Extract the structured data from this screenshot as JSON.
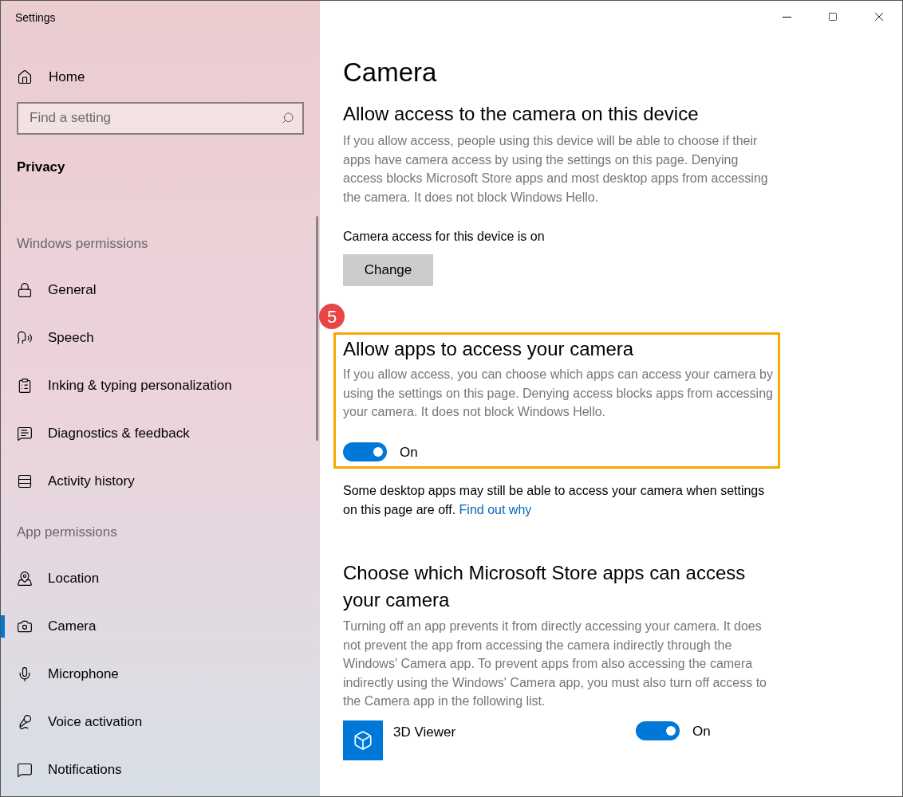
{
  "window": {
    "title": "Settings"
  },
  "sidebar": {
    "home": "Home",
    "search": {
      "placeholder": "Find a setting"
    },
    "section_title": "Privacy",
    "groups": [
      {
        "heading": "Windows permissions",
        "items": [
          {
            "label": "General",
            "selected": false
          },
          {
            "label": "Speech",
            "selected": false
          },
          {
            "label": "Inking & typing personalization",
            "selected": false
          },
          {
            "label": "Diagnostics & feedback",
            "selected": false
          },
          {
            "label": "Activity history",
            "selected": false
          }
        ]
      },
      {
        "heading": "App permissions",
        "items": [
          {
            "label": "Location",
            "selected": false
          },
          {
            "label": "Camera",
            "selected": true
          },
          {
            "label": "Microphone",
            "selected": false
          },
          {
            "label": "Voice activation",
            "selected": false
          },
          {
            "label": "Notifications",
            "selected": false
          }
        ]
      }
    ]
  },
  "page": {
    "title": "Camera",
    "sections": [
      {
        "kind": "device",
        "heading": "Allow access to the camera on this device",
        "description": "If you allow access, people using this device will be able to choose if their apps have camera access by using the settings on this page. Denying access blocks Microsoft Store apps and most desktop apps from accessing the camera. It does not block Windows Hello.",
        "status": "Camera access for this device is on",
        "button": "Change"
      },
      {
        "kind": "toggle",
        "badge": "5",
        "highlighted": true,
        "heading": "Allow apps to access your camera",
        "description": "If you allow access, you can choose which apps can access your camera by using the settings on this page. Denying access blocks apps from accessing your camera. It does not block Windows Hello.",
        "toggle": {
          "on": true,
          "label": "On"
        }
      },
      {
        "kind": "note",
        "text": "Some desktop apps may still be able to access your camera when settings on this page are off.",
        "link": "Find out why"
      },
      {
        "kind": "apps",
        "heading": "Choose which Microsoft Store apps can access your camera",
        "description": "Turning off an app prevents it from directly accessing your camera. It does not prevent the app from accessing the camera indirectly through the Windows' Camera app. To prevent apps from also accessing the camera indirectly using the Windows' Camera app, you must also turn off access to the Camera app in the following list.",
        "apps": [
          {
            "name": "3D Viewer",
            "toggle": {
              "on": true,
              "label": "On"
            }
          }
        ]
      }
    ]
  }
}
